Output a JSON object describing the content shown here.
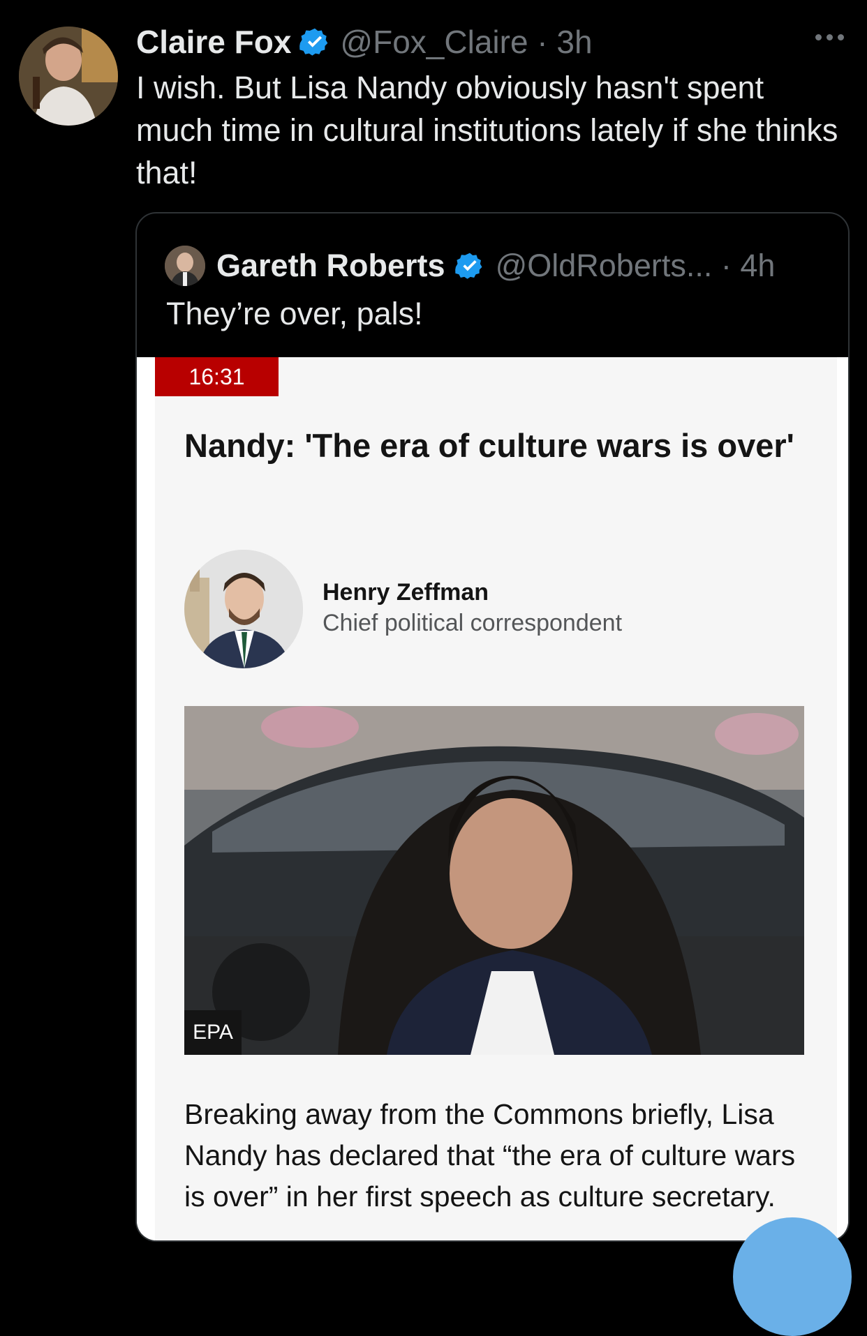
{
  "tweet": {
    "author_name": "Claire Fox",
    "handle_time": "@Fox_Claire · 3h",
    "text": "I wish. But Lisa Nandy obviously hasn't spent much time in cultural institutions lately if she thinks that!",
    "more_icon": "ellipsis-icon"
  },
  "quoted_tweet": {
    "author_name": "Gareth Roberts",
    "handle_time": "@OldRoberts... · 4h",
    "text": "They’re over, pals!"
  },
  "article": {
    "time": "16:31",
    "headline": "Nandy: 'The era of culture wars is over'",
    "author": "Henry Zeffman",
    "author_role": "Chief political correspondent",
    "photo_credit": "EPA",
    "body": "Breaking away from the Commons briefly, Lisa Nandy has declared that “the era of culture wars is over” in her first speech as culture secretary."
  },
  "colors": {
    "background": "#000000",
    "verified_badge": "#1d9bf0",
    "bbc_red": "#b80000",
    "secondary_text": "#71767b"
  }
}
